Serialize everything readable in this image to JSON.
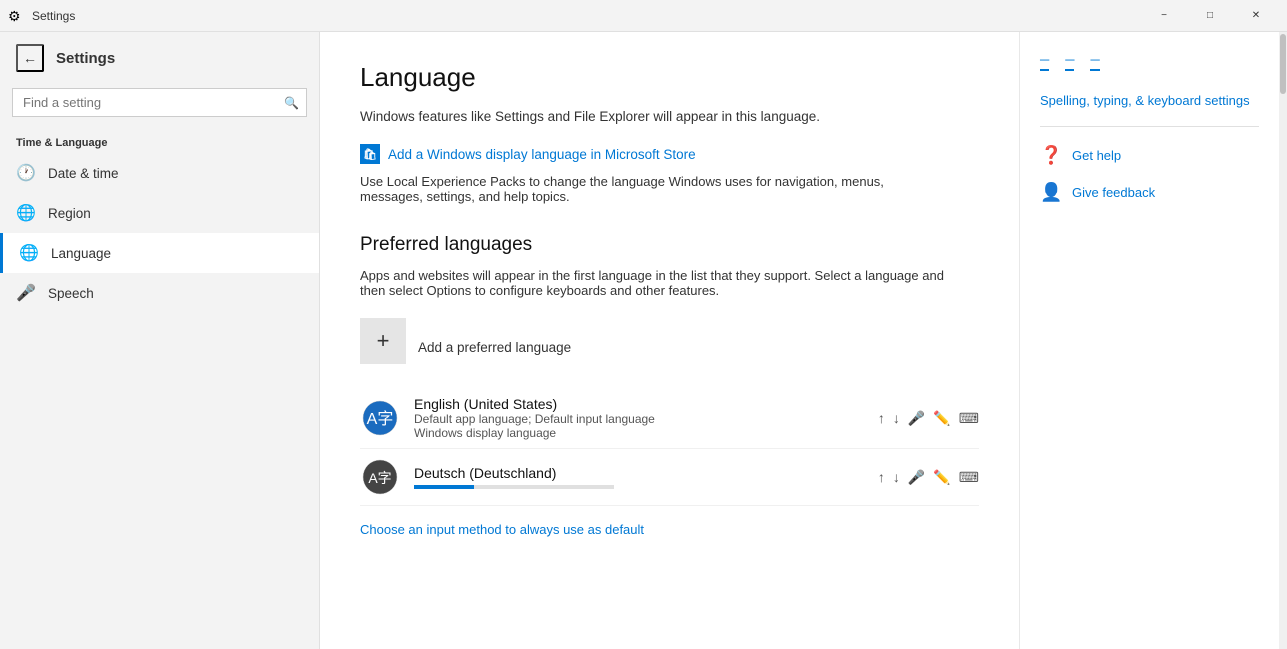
{
  "titlebar": {
    "title": "Settings",
    "minimize_label": "−",
    "maximize_label": "□",
    "close_label": "✕"
  },
  "sidebar": {
    "back_label": "←",
    "app_title": "Settings",
    "search_placeholder": "Find a setting",
    "section_label": "Time & Language",
    "nav_items": [
      {
        "id": "date-time",
        "icon": "🕐",
        "label": "Date & time"
      },
      {
        "id": "region",
        "icon": "🌐",
        "label": "Region"
      },
      {
        "id": "language",
        "icon": "🌐",
        "label": "Language",
        "active": true
      },
      {
        "id": "speech",
        "icon": "🎤",
        "label": "Speech"
      }
    ]
  },
  "content": {
    "page_title": "Language",
    "page_desc": "Windows features like Settings and File Explorer will appear in this language.",
    "store_link_text": "Add a Windows display language in Microsoft Store",
    "store_desc": "Use Local Experience Packs to change the language Windows uses for navigation, menus, messages, settings, and help topics.",
    "preferred_heading": "Preferred languages",
    "preferred_desc": "Apps and websites will appear in the first language in the list that they support. Select a language and then select Options to configure keyboards and other features.",
    "add_lang_label": "Add a preferred language",
    "languages": [
      {
        "id": "en-us",
        "icon": "🌐",
        "name": "English (United States)",
        "meta1": "Default app language; Default input language",
        "meta2": "Windows display language",
        "has_loading": false
      },
      {
        "id": "de-de",
        "icon": "🌐",
        "name": "Deutsch (Deutschland)",
        "meta1": "",
        "meta2": "",
        "has_loading": true
      }
    ],
    "choose_input_link": "Choose an input method to always use as default"
  },
  "right_panel": {
    "top_links": [
      {
        "label": "─"
      },
      {
        "label": "─"
      },
      {
        "label": "─"
      }
    ],
    "related_settings_link": "Spelling, typing, & keyboard settings",
    "links": [
      {
        "icon": "❓",
        "label": "Get help"
      },
      {
        "icon": "👤",
        "label": "Give feedback"
      }
    ]
  }
}
